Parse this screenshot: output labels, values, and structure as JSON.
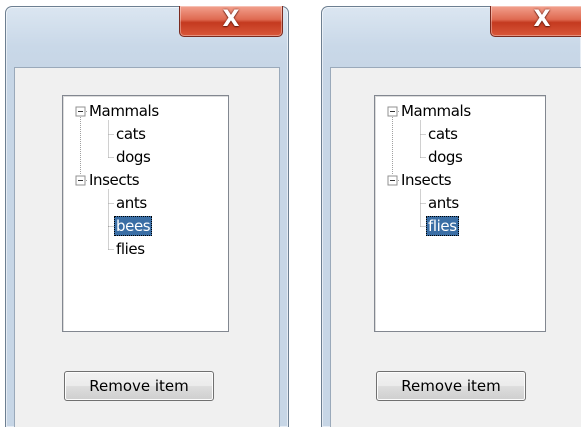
{
  "windows": [
    {
      "close_label": "X",
      "tree": {
        "nodes": [
          {
            "label": "Mammals",
            "expander": "⊟",
            "level": 0,
            "selected": false
          },
          {
            "label": "cats",
            "level": 1,
            "selected": false
          },
          {
            "label": "dogs",
            "level": 1,
            "selected": false
          },
          {
            "label": "Insects",
            "expander": "⊟",
            "level": 0,
            "selected": false
          },
          {
            "label": "ants",
            "level": 1,
            "selected": false
          },
          {
            "label": "bees",
            "level": 1,
            "selected": true
          },
          {
            "label": "flies",
            "level": 1,
            "selected": false
          }
        ]
      },
      "button_label": "Remove item"
    },
    {
      "close_label": "X",
      "tree": {
        "nodes": [
          {
            "label": "Mammals",
            "expander": "⊟",
            "level": 0,
            "selected": false
          },
          {
            "label": "cats",
            "level": 1,
            "selected": false
          },
          {
            "label": "dogs",
            "level": 1,
            "selected": false
          },
          {
            "label": "Insects",
            "expander": "⊟",
            "level": 0,
            "selected": false
          },
          {
            "label": "ants",
            "level": 1,
            "selected": false
          },
          {
            "label": "flies",
            "level": 1,
            "selected": true
          }
        ]
      },
      "button_label": "Remove item"
    }
  ],
  "colors": {
    "selection": "#3a6ea5",
    "close_button": "#c43a1f",
    "frame": "#c7d6e6"
  }
}
